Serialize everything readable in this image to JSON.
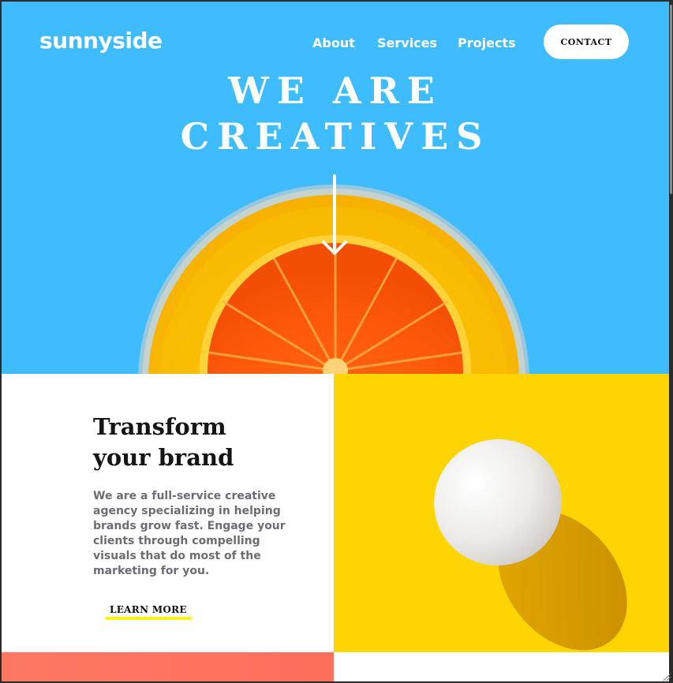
{
  "header": {
    "logo": "sunnyside",
    "nav": [
      {
        "label": "About"
      },
      {
        "label": "Services"
      },
      {
        "label": "Projects"
      }
    ],
    "contact_label": "CONTACT"
  },
  "hero": {
    "title_line1": "WE ARE",
    "title_line2": "CREATIVES",
    "arrow_icon": "arrow-down-icon",
    "background_color": "#3ebcfd"
  },
  "transform": {
    "title_line1": "Transform",
    "title_line2": "your brand",
    "body": "We are a full-service creative agency specializing in helping brands grow fast. Engage your clients through compelling visuals that do most of the marketing for you.",
    "cta_label": "LEARN MORE",
    "cta_underline_color": "#fff30f",
    "panel_color": "#fed402"
  },
  "colors": {
    "hero_blue": "#3ebcfd",
    "yellow": "#fed402",
    "coral": "#fe6f5c"
  }
}
